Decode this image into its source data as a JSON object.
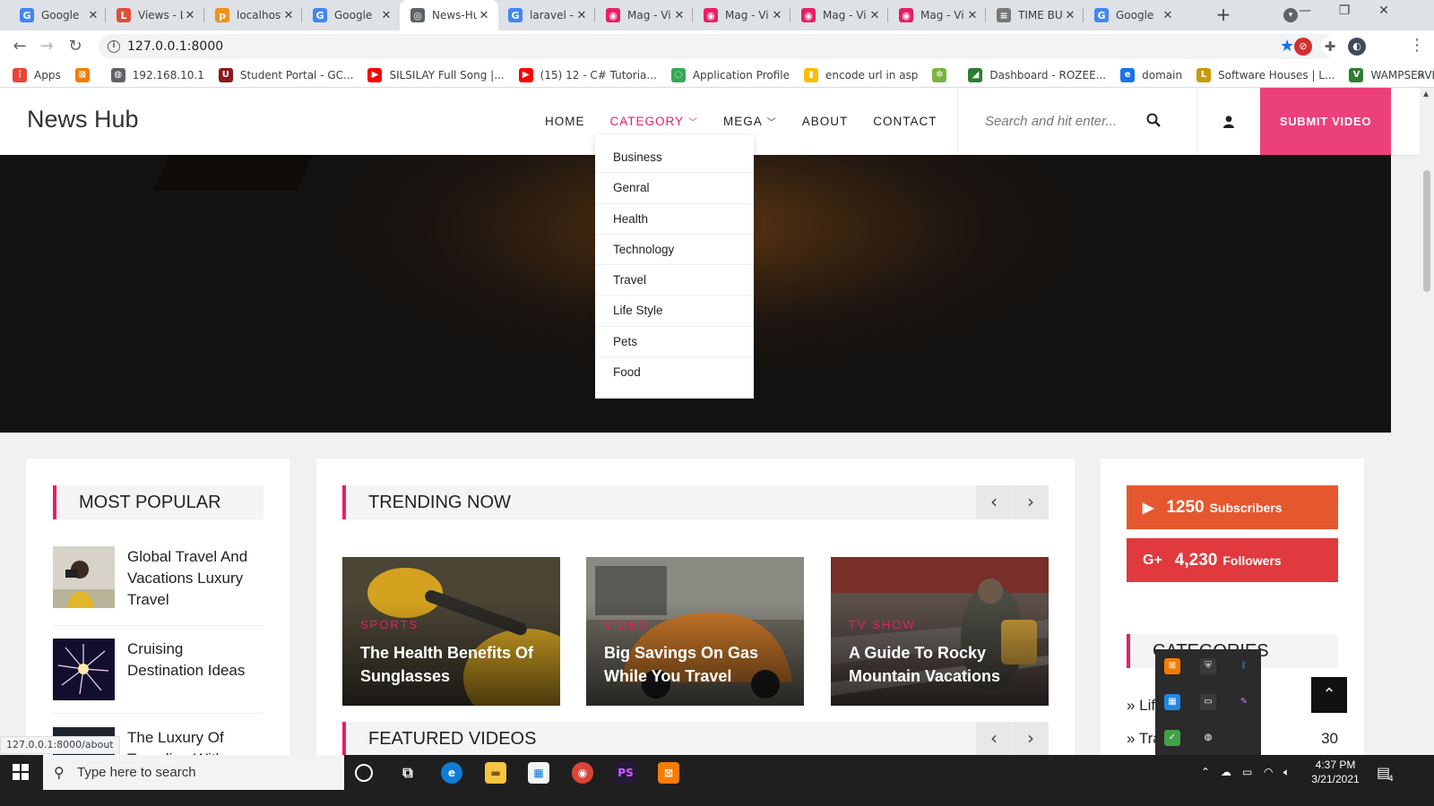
{
  "browser": {
    "tabs": [
      {
        "title": "Google",
        "favicon": "G",
        "color": "#4285f4",
        "active": false
      },
      {
        "title": "Views - L",
        "favicon": "L",
        "color": "#e04e39",
        "active": false
      },
      {
        "title": "localhost",
        "favicon": "p",
        "color": "#f29111",
        "active": false
      },
      {
        "title": "Google",
        "favicon": "G",
        "color": "#4285f4",
        "active": false
      },
      {
        "title": "News-Hu",
        "favicon": "◎",
        "color": "#5f6368",
        "active": true
      },
      {
        "title": "laravel -",
        "favicon": "G",
        "color": "#4285f4",
        "active": false
      },
      {
        "title": "Mag - Vi",
        "favicon": "◉",
        "color": "#e91e63",
        "active": false
      },
      {
        "title": "Mag - Vi",
        "favicon": "◉",
        "color": "#e91e63",
        "active": false
      },
      {
        "title": "Mag - Vi",
        "favicon": "◉",
        "color": "#e91e63",
        "active": false
      },
      {
        "title": "Mag - Vi",
        "favicon": "◉",
        "color": "#e91e63",
        "active": false
      },
      {
        "title": "TIME BU",
        "favicon": "≡",
        "color": "#777777",
        "active": false
      },
      {
        "title": "Google",
        "favicon": "G",
        "color": "#4285f4",
        "active": false
      }
    ],
    "url": "127.0.0.1:8000",
    "bookmarks": [
      {
        "label": "Apps",
        "color": "#ea4335",
        "icon": "⋮"
      },
      {
        "label": "",
        "color": "#f57c00",
        "icon": "⊠"
      },
      {
        "label": "192.168.10.1",
        "color": "#5f6368",
        "icon": "◍"
      },
      {
        "label": "Student Portal - GC...",
        "color": "#8b1a1a",
        "icon": "U"
      },
      {
        "label": "SILSILAY Full Song |...",
        "color": "#ff0000",
        "icon": "▶"
      },
      {
        "label": "(15) 12 - C# Tutoria...",
        "color": "#ff0000",
        "icon": "▶"
      },
      {
        "label": "Application Profile",
        "color": "#34a853",
        "icon": "◌"
      },
      {
        "label": "encode url in asp",
        "color": "#fbbc04",
        "icon": "▮"
      },
      {
        "label": "",
        "color": "#7cb342",
        "icon": "✲"
      },
      {
        "label": "Dashboard - ROZEE...",
        "color": "#2e7d32",
        "icon": "◢"
      },
      {
        "label": "domain",
        "color": "#1a73e8",
        "icon": "e"
      },
      {
        "label": "Software Houses | L...",
        "color": "#c99a06",
        "icon": "L"
      },
      {
        "label": "WAMPSERVER Ho...",
        "color": "#2e7d32",
        "icon": "V"
      }
    ],
    "status_url": "127.0.0.1:8000/about"
  },
  "site": {
    "logo": "News Hub",
    "nav": [
      {
        "label": "HOME",
        "caret": false,
        "active": false
      },
      {
        "label": "CATEGORY",
        "caret": true,
        "active": true
      },
      {
        "label": "MEGA",
        "caret": true,
        "active": false
      },
      {
        "label": "ABOUT",
        "caret": false,
        "active": false
      },
      {
        "label": "CONTACT",
        "caret": false,
        "active": false
      }
    ],
    "search_placeholder": "Search and hit enter...",
    "submit_label": "SUBMIT VIDEO",
    "accent": "#ec407a",
    "category_menu": [
      "Business",
      "Genral",
      "Health",
      "Technology",
      "Travel",
      "Life Style",
      "Pets",
      "Food"
    ],
    "most_popular": {
      "title": "MOST POPULAR",
      "items": [
        {
          "title": "Global Travel And Vacations Luxury Travel"
        },
        {
          "title": "Cruising Destination Ideas"
        },
        {
          "title": "The Luxury Of Traveling With"
        }
      ]
    },
    "trending": {
      "title": "TRENDING NOW",
      "cards": [
        {
          "category": "SPORTS",
          "title": "The Health Benefits Of Sunglasses"
        },
        {
          "category": "VIDEO",
          "title": "Big Savings On Gas While You Travel"
        },
        {
          "category": "TV SHOW",
          "title": "A Guide To Rocky Mountain Vacations"
        }
      ]
    },
    "featured_title": "FEATURED VIDEOS",
    "social": [
      {
        "icon": "▶",
        "count": "1250",
        "label": "Subscribers",
        "color": "#e5582f"
      },
      {
        "icon": "G+",
        "count": "4,230",
        "label": "Followers",
        "color": "#e03a3e"
      }
    ],
    "categories_title": "CATEGORIES",
    "category_counts": [
      {
        "name": "» Life",
        "count": ""
      },
      {
        "name": "» Tra",
        "count": "30"
      }
    ]
  },
  "taskbar": {
    "search_placeholder": "Type here to search",
    "time": "4:37 PM",
    "date": "3/21/2021",
    "notification_count": "4"
  }
}
